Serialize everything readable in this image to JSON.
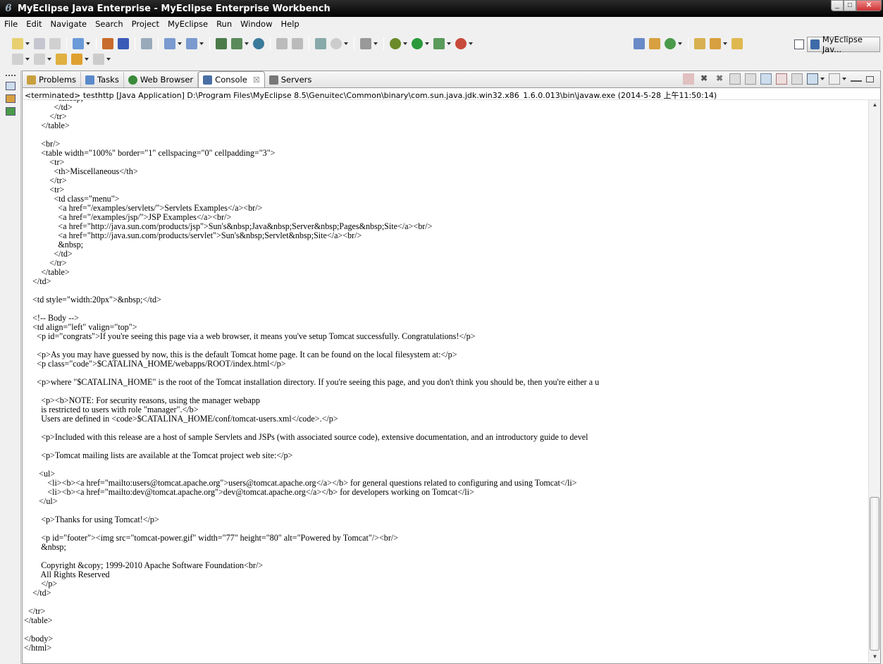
{
  "window": {
    "title": "MyEclipse Java Enterprise - MyEclipse Enterprise Workbench",
    "minimize": "_",
    "maximize": "□",
    "close": "✕"
  },
  "menu": [
    "File",
    "Edit",
    "Navigate",
    "Search",
    "Project",
    "MyEclipse",
    "Run",
    "Window",
    "Help"
  ],
  "perspective": {
    "label": "MyEclipse Jav..."
  },
  "tabs": [
    {
      "label": "Problems",
      "icon": "problems-icon",
      "color": "#c8a040"
    },
    {
      "label": "Tasks",
      "icon": "tasks-icon",
      "color": "#5a8acb"
    },
    {
      "label": "Web Browser",
      "icon": "globe-icon",
      "color": "#3a8a3a"
    },
    {
      "label": "Console",
      "icon": "console-icon",
      "color": "#4a6fa5",
      "active": true,
      "close": "☒"
    },
    {
      "label": "Servers",
      "icon": "servers-icon",
      "color": "#777777"
    }
  ],
  "console": {
    "status": "<terminated> testhttp [Java Application] D:\\Program Files\\MyEclipse 8.5\\Genuitec\\Common\\binary\\com.sun.java.jdk.win32.x86_1.6.0.013\\bin\\javaw.exe (2014-5-28 上午11:50:14)",
    "output": "                &nbsp;\n              </td>\n            </tr>\n        </table>\n\n        <br/>\n        <table width=\"100%\" border=\"1\" cellspacing=\"0\" cellpadding=\"3\">\n            <tr>\n              <th>Miscellaneous</th>\n            </tr>\n            <tr>\n              <td class=\"menu\">\n                <a href=\"/examples/servlets/\">Servlets Examples</a><br/>\n                <a href=\"/examples/jsp/\">JSP Examples</a><br/>\n                <a href=\"http://java.sun.com/products/jsp\">Sun's&nbsp;Java&nbsp;Server&nbsp;Pages&nbsp;Site</a><br/>\n                <a href=\"http://java.sun.com/products/servlet\">Sun's&nbsp;Servlet&nbsp;Site</a><br/>\n                &nbsp;\n              </td>\n            </tr>\n        </table>\n    </td>\n\n    <td style=\"width:20px\">&nbsp;</td>\n\n    <!-- Body -->\n    <td align=\"left\" valign=\"top\">\n      <p id=\"congrats\">If you're seeing this page via a web browser, it means you've setup Tomcat successfully. Congratulations!</p>\n\n      <p>As you may have guessed by now, this is the default Tomcat home page. It can be found on the local filesystem at:</p>\n      <p class=\"code\">$CATALINA_HOME/webapps/ROOT/index.html</p>\n\n      <p>where \"$CATALINA_HOME\" is the root of the Tomcat installation directory. If you're seeing this page, and you don't think you should be, then you're either a u\n\n        <p><b>NOTE: For security reasons, using the manager webapp\n        is restricted to users with role \"manager\".</b>\n        Users are defined in <code>$CATALINA_HOME/conf/tomcat-users.xml</code>.</p>\n\n        <p>Included with this release are a host of sample Servlets and JSPs (with associated source code), extensive documentation, and an introductory guide to devel\n\n        <p>Tomcat mailing lists are available at the Tomcat project web site:</p>\n\n       <ul>\n           <li><b><a href=\"mailto:users@tomcat.apache.org\">users@tomcat.apache.org</a></b> for general questions related to configuring and using Tomcat</li>\n           <li><b><a href=\"mailto:dev@tomcat.apache.org\">dev@tomcat.apache.org</a></b> for developers working on Tomcat</li>\n       </ul>\n\n        <p>Thanks for using Tomcat!</p>\n\n        <p id=\"footer\"><img src=\"tomcat-power.gif\" width=\"77\" height=\"80\" alt=\"Powered by Tomcat\"/><br/>\n        &nbsp;\n\n        Copyright &copy; 1999-2010 Apache Software Foundation<br/>\n        All Rights Reserved\n        </p>\n    </td>\n\n  </tr>\n</table>\n\n</body>\n</html>"
  }
}
